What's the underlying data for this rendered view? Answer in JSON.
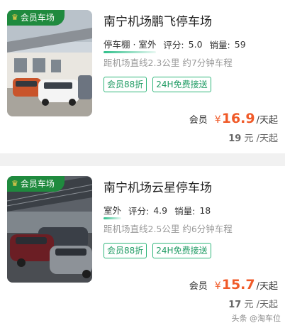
{
  "listings": [
    {
      "badge": "会员车场",
      "title": "南宁机场鹏飞停车场",
      "type": "停车棚 · 室外",
      "rating_label": "评分:",
      "rating": "5.0",
      "sales_label": "销量:",
      "sales": "59",
      "distance": "距机场直线2.3公里 约7分钟车程",
      "tags": [
        "会员88折",
        "24H免费接送"
      ],
      "member_label": "会员",
      "currency": "¥",
      "member_price": "16.9",
      "unit": "/天起",
      "original_price": "19",
      "original_unit": "元 /天起"
    },
    {
      "badge": "会员车场",
      "title": "南宁机场云星停车场",
      "type": "室外",
      "rating_label": "评分:",
      "rating": "4.9",
      "sales_label": "销量:",
      "sales": "18",
      "distance": "距机场直线2.5公里 约6分钟车程",
      "tags": [
        "会员88折",
        "24H免费接送"
      ],
      "member_label": "会员",
      "currency": "¥",
      "member_price": "15.7",
      "unit": "/天起",
      "original_price": "17",
      "original_unit": "元 /天起"
    }
  ],
  "watermark": "头条 @淘车位",
  "colors": {
    "accent": "#f05a28",
    "tag": "#2fb67a",
    "badge": "#1f8a3e"
  }
}
